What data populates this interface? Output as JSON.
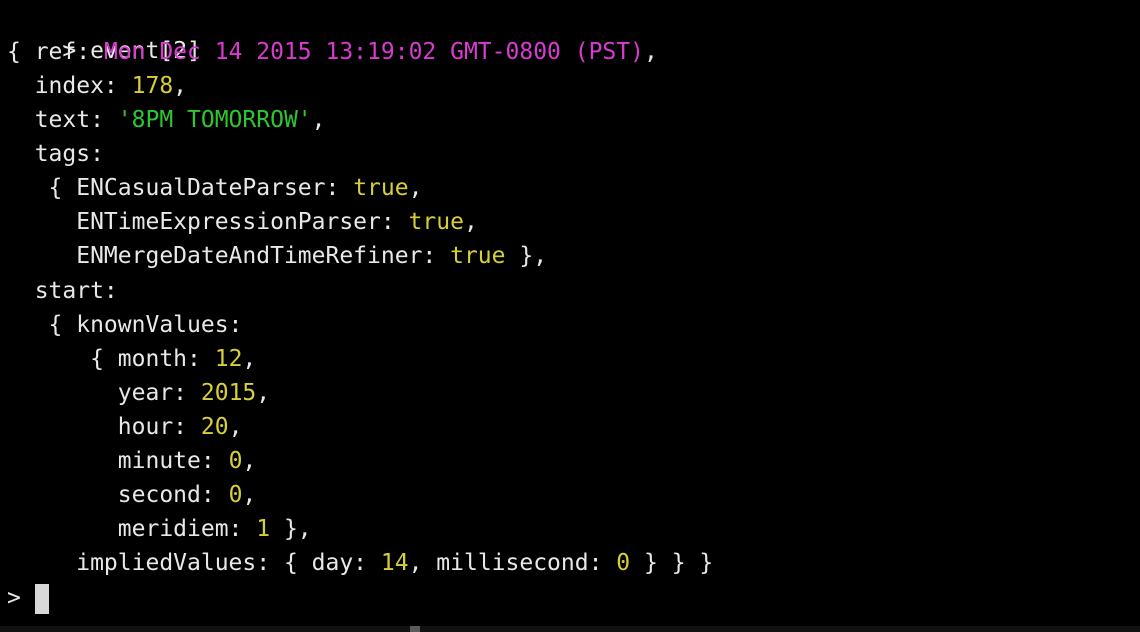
{
  "terminal": {
    "prompt": ">",
    "command": "event[2]",
    "lines": {
      "l1_open": "{ ref: ",
      "l1_ref": "Mon Dec 14 2015 13:19:02 GMT-0800 (PST)",
      "l1_comma": ",",
      "l2_key": "  index: ",
      "l2_val": "178",
      "l2_comma": ",",
      "l3_key": "  text: ",
      "l3_val": "'8PM TOMORROW'",
      "l3_comma": ",",
      "l4_key": "  tags:",
      "l5_key": "   { ENCasualDateParser: ",
      "l5_val": "true",
      "l5_comma": ",",
      "l6_key": "     ENTimeExpressionParser: ",
      "l6_val": "true",
      "l6_comma": ",",
      "l7_key": "     ENMergeDateAndTimeRefiner: ",
      "l7_val": "true",
      "l7_tail": " },",
      "l8_key": "  start:",
      "l9_key": "   { knownValues:",
      "l10_key": "      { month: ",
      "l10_val": "12",
      "l10_comma": ",",
      "l11_key": "        year: ",
      "l11_val": "2015",
      "l11_comma": ",",
      "l12_key": "        hour: ",
      "l12_val": "20",
      "l12_comma": ",",
      "l13_key": "        minute: ",
      "l13_val": "0",
      "l13_comma": ",",
      "l14_key": "        second: ",
      "l14_val": "0",
      "l14_comma": ",",
      "l15_key": "        meridiem: ",
      "l15_val": "1",
      "l15_tail": " },",
      "l16_key": "     impliedValues: { day: ",
      "l16_val1": "14",
      "l16_mid": ", millisecond: ",
      "l16_val2": "0",
      "l16_tail": " } } }"
    },
    "prompt2": "> "
  },
  "colors": {
    "background": "#000000",
    "text": "#e8e8e8",
    "number": "#d7cf3a",
    "string": "#2ec630",
    "date": "#d93ad0"
  }
}
